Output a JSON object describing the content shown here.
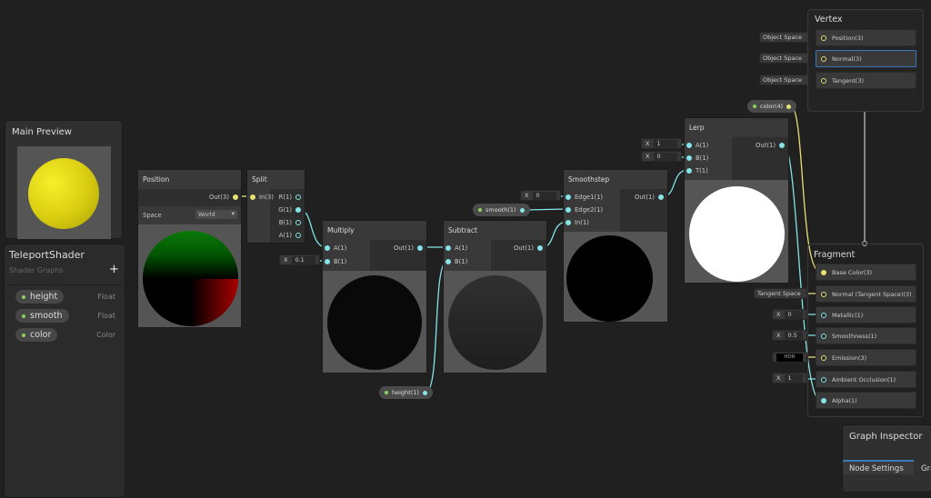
{
  "main_preview": {
    "title": "Main Preview"
  },
  "blackboard": {
    "title": "TeleportShader",
    "subtitle": "Shader Graphs",
    "add_label": "+",
    "properties": [
      {
        "name": "height",
        "type": "Float"
      },
      {
        "name": "smooth",
        "type": "Float"
      },
      {
        "name": "color",
        "type": "Color"
      }
    ]
  },
  "nodes": {
    "position": {
      "title": "Position",
      "out": "Out(3)",
      "space_label": "Space",
      "space_value": "World"
    },
    "split": {
      "title": "Split",
      "in": "In(3)",
      "outs": [
        "R(1)",
        "G(1)",
        "B(1)",
        "A(1)"
      ]
    },
    "multiply": {
      "title": "Multiply",
      "a": "A(1)",
      "b": "B(1)",
      "out": "Out(1)",
      "b_x": "X",
      "b_value": "0.1"
    },
    "subtract": {
      "title": "Subtract",
      "a": "A(1)",
      "b": "B(1)",
      "out": "Out(1)"
    },
    "smoothstep": {
      "title": "Smoothstep",
      "edge1": "Edge1(1)",
      "edge2": "Edge2(1)",
      "in": "In(1)",
      "out": "Out(1)",
      "edge1_x": "X",
      "edge1_value": "0"
    },
    "lerp": {
      "title": "Lerp",
      "a": "A(1)",
      "b": "B(1)",
      "t": "T(1)",
      "out": "Out(1)",
      "a_x": "X",
      "a_value": "1",
      "b_x": "X",
      "b_value": "0"
    }
  },
  "property_nodes": {
    "color": "color(4)",
    "smooth": "smooth(1)",
    "height": "height(1)"
  },
  "vertex": {
    "title": "Vertex",
    "slots": [
      {
        "label": "Position(3)",
        "input": "Object Space"
      },
      {
        "label": "Normal(3)",
        "input": "Object Space"
      },
      {
        "label": "Tangent(3)",
        "input": "Object Space"
      }
    ]
  },
  "fragment": {
    "title": "Fragment",
    "slots": [
      {
        "label": "Base Color(3)"
      },
      {
        "label": "Normal (Tangent Space)(3)",
        "input": "Tangent Space"
      },
      {
        "label": "Metallic(1)",
        "x": "X",
        "input": "0"
      },
      {
        "label": "Smoothness(1)",
        "x": "X",
        "input": "0.5"
      },
      {
        "label": "Emission(3)",
        "input": "HDR"
      },
      {
        "label": "Ambient Occlusion(1)",
        "x": "X",
        "input": "1"
      },
      {
        "label": "Alpha(1)"
      }
    ]
  },
  "graph_inspector": {
    "title": "Graph Inspector",
    "tabs": [
      "Node Settings",
      "Gra"
    ]
  },
  "colors": {
    "float_wire": "#84e4e7",
    "vector_wire": "#e8e275",
    "accent": "#3a79bb"
  }
}
